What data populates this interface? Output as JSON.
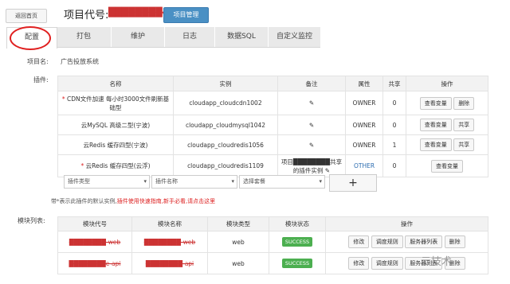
{
  "header": {
    "back_label": "返回首页",
    "project_code_label": "项目代号:",
    "project_code_value": "████████e",
    "manage_button": "项目管理"
  },
  "tabs": [
    "配置",
    "打包",
    "维护",
    "日志",
    "数据SQL",
    "自定义监控"
  ],
  "project_name": {
    "label": "项目名:",
    "value": "广告投放系统"
  },
  "plugins": {
    "label": "插件:",
    "headers": [
      "名称",
      "实例",
      "备注",
      "属性",
      "共享",
      "操作"
    ],
    "rows": [
      {
        "name": "CDN文件加速 每小时3000文件刷新基础型",
        "instance": "cloudapp_cloudcdn1002",
        "remark": "",
        "attr": "OWNER",
        "share": "0",
        "ops": [
          "查看变量",
          "删除"
        ]
      },
      {
        "name": "云MySQL 高级二型(宁波)",
        "instance": "cloudapp_cloudmysql1042",
        "remark": "",
        "attr": "OWNER",
        "share": "0",
        "ops": [
          "查看变量",
          "共享"
        ]
      },
      {
        "name": "云Redis 缓存四型(宁波)",
        "instance": "cloudapp_cloudredis1056",
        "remark": "",
        "attr": "OWNER",
        "share": "1",
        "ops": [
          "查看变量",
          "共享"
        ]
      },
      {
        "name": "云Redis 缓存四型(云浮)",
        "instance": "cloudapp_cloudredis1109",
        "remark": "项目████████共享的插件实例",
        "attr": "OTHER",
        "share": "0",
        "ops": [
          "查看变量"
        ]
      }
    ],
    "selects": [
      "插件类型",
      "插件名称",
      "选择套餐"
    ],
    "add_label": "+"
  },
  "note": {
    "prefix": "带*表示此插件的默认实例,",
    "red": "插件使用快速指南,新手必看,请点击这里"
  },
  "modules": {
    "label": "模块列表:",
    "headers": [
      "模块代号",
      "模块名称",
      "模块类型",
      "模块状态",
      "操作"
    ],
    "rows": [
      {
        "code": "████████-web",
        "name": "████████-web",
        "type": "web",
        "status": "SUCCESS",
        "ops": [
          "修改",
          "调度规则",
          "服务器列表",
          "删除"
        ]
      },
      {
        "code": "████████e-api",
        "name": "████████-api",
        "type": "web",
        "status": "SUCCESS",
        "ops": [
          "修改",
          "调度规则",
          "服务器列表",
          "删除"
        ]
      }
    ]
  },
  "watermark": "云技术"
}
